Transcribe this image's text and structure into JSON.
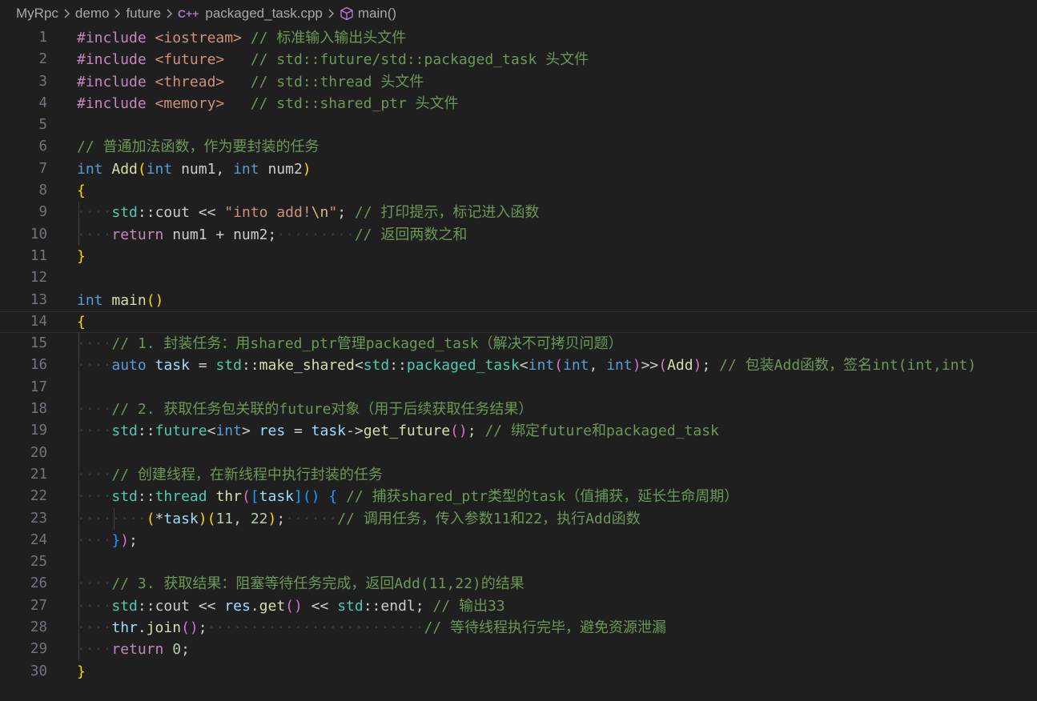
{
  "breadcrumb": {
    "items": [
      "MyRpc",
      "demo",
      "future",
      "packaged_task.cpp",
      "main()"
    ],
    "file_icon": "C++"
  },
  "editor": {
    "current_line": 14,
    "lines": [
      {
        "n": "1",
        "indent": 0,
        "tokens": [
          [
            "#include ",
            "pp"
          ],
          [
            "<iostream>",
            "ppv"
          ],
          [
            " // 标准输入输出头文件",
            "cmt"
          ]
        ]
      },
      {
        "n": "2",
        "indent": 0,
        "tokens": [
          [
            "#include ",
            "pp"
          ],
          [
            "<future>",
            "ppv"
          ],
          [
            "   // std::future/std::packaged_task 头文件",
            "cmt"
          ]
        ]
      },
      {
        "n": "3",
        "indent": 0,
        "tokens": [
          [
            "#include ",
            "pp"
          ],
          [
            "<thread>",
            "ppv"
          ],
          [
            "   // std::thread 头文件",
            "cmt"
          ]
        ]
      },
      {
        "n": "4",
        "indent": 0,
        "tokens": [
          [
            "#include ",
            "pp"
          ],
          [
            "<memory>",
            "ppv"
          ],
          [
            "   // std::shared_ptr 头文件",
            "cmt"
          ]
        ]
      },
      {
        "n": "5",
        "indent": 0,
        "tokens": []
      },
      {
        "n": "6",
        "indent": 0,
        "tokens": [
          [
            "// 普通加法函数，作为要封装的任务",
            "cmt"
          ]
        ]
      },
      {
        "n": "7",
        "indent": 0,
        "tokens": [
          [
            "int",
            "kw"
          ],
          [
            " ",
            "plain"
          ],
          [
            "Add",
            "fn"
          ],
          [
            "(",
            "b1"
          ],
          [
            "int",
            "kw"
          ],
          [
            " num1, ",
            "plain"
          ],
          [
            "int",
            "kw"
          ],
          [
            " num2",
            "plain"
          ],
          [
            ")",
            "b1"
          ]
        ]
      },
      {
        "n": "8",
        "indent": 0,
        "tokens": [
          [
            "{",
            "b1"
          ]
        ]
      },
      {
        "n": "9",
        "indent": 1,
        "tokens": [
          [
            "····",
            "ws"
          ],
          [
            "std",
            "type"
          ],
          [
            "::",
            "plain"
          ],
          [
            "cout",
            "plain"
          ],
          [
            " << ",
            "plain"
          ],
          [
            "\"into add!",
            "str"
          ],
          [
            "\\n",
            "esc"
          ],
          [
            "\"",
            "str"
          ],
          [
            "; ",
            "plain"
          ],
          [
            "// 打印提示，标记进入函数",
            "cmt"
          ]
        ]
      },
      {
        "n": "10",
        "indent": 1,
        "tokens": [
          [
            "····",
            "ws"
          ],
          [
            "return",
            "ctl"
          ],
          [
            " num1 + num2;",
            "plain"
          ],
          [
            "·········",
            "ws"
          ],
          [
            "// 返回两数之和",
            "cmt"
          ]
        ]
      },
      {
        "n": "11",
        "indent": 0,
        "tokens": [
          [
            "}",
            "b1"
          ]
        ]
      },
      {
        "n": "12",
        "indent": 0,
        "tokens": []
      },
      {
        "n": "13",
        "indent": 0,
        "tokens": [
          [
            "int",
            "kw"
          ],
          [
            " ",
            "plain"
          ],
          [
            "main",
            "fn"
          ],
          [
            "()",
            "b1"
          ]
        ]
      },
      {
        "n": "14",
        "indent": 0,
        "tokens": [
          [
            "{",
            "b1"
          ]
        ]
      },
      {
        "n": "15",
        "indent": 1,
        "tokens": [
          [
            "····",
            "ws"
          ],
          [
            "// 1. 封装任务：用shared_ptr管理packaged_task（解决不可拷贝问题）",
            "cmt"
          ]
        ]
      },
      {
        "n": "16",
        "indent": 1,
        "tokens": [
          [
            "····",
            "ws"
          ],
          [
            "auto",
            "kw"
          ],
          [
            " ",
            "plain"
          ],
          [
            "task",
            "var"
          ],
          [
            " = ",
            "plain"
          ],
          [
            "std",
            "type"
          ],
          [
            "::",
            "plain"
          ],
          [
            "make_shared",
            "fn"
          ],
          [
            "<",
            "plain"
          ],
          [
            "std",
            "type"
          ],
          [
            "::",
            "plain"
          ],
          [
            "packaged_task",
            "type"
          ],
          [
            "<",
            "plain"
          ],
          [
            "int",
            "kw"
          ],
          [
            "(",
            "b2"
          ],
          [
            "int",
            "kw"
          ],
          [
            ", ",
            "plain"
          ],
          [
            "int",
            "kw"
          ],
          [
            ")",
            "b2"
          ],
          [
            ">>",
            "plain"
          ],
          [
            "(",
            "b2"
          ],
          [
            "Add",
            "fn"
          ],
          [
            ")",
            "b2"
          ],
          [
            "; ",
            "plain"
          ],
          [
            "// 包装Add函数，签名int(int,int)",
            "cmt"
          ]
        ]
      },
      {
        "n": "17",
        "indent": 1,
        "tokens": []
      },
      {
        "n": "18",
        "indent": 1,
        "tokens": [
          [
            "····",
            "ws"
          ],
          [
            "// 2. 获取任务包关联的future对象（用于后续获取任务结果）",
            "cmt"
          ]
        ]
      },
      {
        "n": "19",
        "indent": 1,
        "tokens": [
          [
            "····",
            "ws"
          ],
          [
            "std",
            "type"
          ],
          [
            "::",
            "plain"
          ],
          [
            "future",
            "type"
          ],
          [
            "<",
            "plain"
          ],
          [
            "int",
            "kw"
          ],
          [
            "> ",
            "plain"
          ],
          [
            "res",
            "var"
          ],
          [
            " = ",
            "plain"
          ],
          [
            "task",
            "var"
          ],
          [
            "->",
            "plain"
          ],
          [
            "get_future",
            "fn"
          ],
          [
            "()",
            "b2"
          ],
          [
            "; ",
            "plain"
          ],
          [
            "// 绑定future和packaged_task",
            "cmt"
          ]
        ]
      },
      {
        "n": "20",
        "indent": 1,
        "tokens": []
      },
      {
        "n": "21",
        "indent": 1,
        "tokens": [
          [
            "····",
            "ws"
          ],
          [
            "// 创建线程，在新线程中执行封装的任务",
            "cmt"
          ]
        ]
      },
      {
        "n": "22",
        "indent": 1,
        "tokens": [
          [
            "····",
            "ws"
          ],
          [
            "std",
            "type"
          ],
          [
            "::",
            "plain"
          ],
          [
            "thread",
            "type"
          ],
          [
            " ",
            "plain"
          ],
          [
            "thr",
            "fn"
          ],
          [
            "(",
            "b2"
          ],
          [
            "[",
            "b3"
          ],
          [
            "task",
            "var"
          ],
          [
            "]",
            "b3"
          ],
          [
            "()",
            "b3"
          ],
          [
            " ",
            "plain"
          ],
          [
            "{",
            "b3"
          ],
          [
            " ",
            "plain"
          ],
          [
            "// 捕获shared_ptr类型的task（值捕获，延长生命周期）",
            "cmt"
          ]
        ]
      },
      {
        "n": "23",
        "indent": 2,
        "tokens": [
          [
            "········",
            "ws"
          ],
          [
            "(",
            "b1"
          ],
          [
            "*",
            "plain"
          ],
          [
            "task",
            "var"
          ],
          [
            ")",
            "b1"
          ],
          [
            "(",
            "b1"
          ],
          [
            "11",
            "num"
          ],
          [
            ", ",
            "plain"
          ],
          [
            "22",
            "num"
          ],
          [
            ")",
            "b1"
          ],
          [
            ";",
            "plain"
          ],
          [
            "······",
            "ws"
          ],
          [
            "// 调用任务，传入参数11和22，执行Add函数",
            "cmt"
          ]
        ]
      },
      {
        "n": "24",
        "indent": 1,
        "tokens": [
          [
            "····",
            "ws"
          ],
          [
            "}",
            "b3"
          ],
          [
            ")",
            "b2"
          ],
          [
            ";",
            "plain"
          ]
        ]
      },
      {
        "n": "25",
        "indent": 1,
        "tokens": []
      },
      {
        "n": "26",
        "indent": 1,
        "tokens": [
          [
            "····",
            "ws"
          ],
          [
            "// 3. 获取结果：阻塞等待任务完成，返回Add(11,22)的结果",
            "cmt"
          ]
        ]
      },
      {
        "n": "27",
        "indent": 1,
        "tokens": [
          [
            "····",
            "ws"
          ],
          [
            "std",
            "type"
          ],
          [
            "::",
            "plain"
          ],
          [
            "cout",
            "plain"
          ],
          [
            " << ",
            "plain"
          ],
          [
            "res",
            "var"
          ],
          [
            ".",
            "plain"
          ],
          [
            "get",
            "fn"
          ],
          [
            "()",
            "b2"
          ],
          [
            " << ",
            "plain"
          ],
          [
            "std",
            "type"
          ],
          [
            "::",
            "plain"
          ],
          [
            "endl",
            "plain"
          ],
          [
            "; ",
            "plain"
          ],
          [
            "// 输出33",
            "cmt"
          ]
        ]
      },
      {
        "n": "28",
        "indent": 1,
        "tokens": [
          [
            "····",
            "ws"
          ],
          [
            "thr",
            "var"
          ],
          [
            ".",
            "plain"
          ],
          [
            "join",
            "fn"
          ],
          [
            "()",
            "b2"
          ],
          [
            ";",
            "plain"
          ],
          [
            "·························",
            "ws"
          ],
          [
            "// 等待线程执行完毕，避免资源泄漏",
            "cmt"
          ]
        ]
      },
      {
        "n": "29",
        "indent": 1,
        "tokens": [
          [
            "····",
            "ws"
          ],
          [
            "return",
            "ctl"
          ],
          [
            " ",
            "plain"
          ],
          [
            "0",
            "num"
          ],
          [
            ";",
            "plain"
          ]
        ]
      },
      {
        "n": "30",
        "indent": 0,
        "tokens": [
          [
            "}",
            "b1"
          ]
        ]
      }
    ]
  }
}
